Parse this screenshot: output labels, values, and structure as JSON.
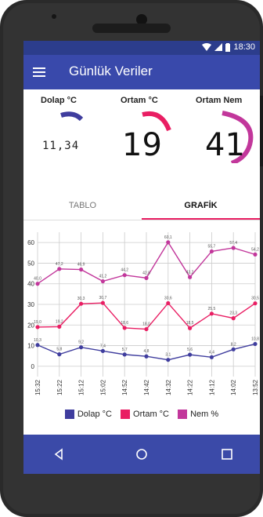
{
  "status": {
    "time": "18:30"
  },
  "appbar": {
    "title": "Günlük Veriler"
  },
  "gauges": {
    "dolap": {
      "label": "Dolap °C",
      "value": "11,34",
      "fraction": 0.2,
      "color": "#3f3d9e"
    },
    "ortam": {
      "label": "Ortam °C",
      "value": "19",
      "fraction": 0.25,
      "color": "#e91e63"
    },
    "nem": {
      "label": "Ortam Nem",
      "value": "41",
      "fraction": 0.41,
      "color": "#c2379b"
    }
  },
  "tabs": {
    "tablo": "TABLO",
    "grafik": "GRAFİK",
    "active": "GRAFİK"
  },
  "legend": {
    "dolap": "Dolap °C",
    "ortam": "Ortam °C",
    "nem": "Nem %"
  },
  "chart_data": {
    "type": "line",
    "categories": [
      "15:32",
      "15:22",
      "15:12",
      "15:02",
      "14:52",
      "14:42",
      "14:32",
      "14:22",
      "14:12",
      "14:02",
      "13:52"
    ],
    "ylim": [
      -5,
      65
    ],
    "yticks": [
      0,
      10,
      20,
      30,
      40,
      50,
      60
    ],
    "grid": true,
    "legend_position": "bottom",
    "series": [
      {
        "name": "Dolap °C",
        "color": "#3f3d9e",
        "values": [
          10.3,
          5.8,
          9.2,
          7.4,
          5.7,
          4.8,
          3.1,
          5.6,
          4.4,
          8.2,
          10.8
        ],
        "labels": [
          "10,3",
          "5,8",
          "9,2",
          "7,4",
          "5,7",
          "4,8",
          "3,1",
          "5,6",
          "4,4",
          "8,2",
          "10,8"
        ]
      },
      {
        "name": "Ortam °C",
        "color": "#e91e63",
        "values": [
          19.0,
          19.2,
          30.3,
          30.7,
          18.6,
          18.0,
          30.6,
          18.5,
          25.5,
          23.3,
          30.5
        ],
        "labels": [
          "19,0",
          "19,2",
          "30,3",
          "30,7",
          "18,6",
          "18,0",
          "30,6",
          "18,5",
          "25,5",
          "23,3",
          "30,5"
        ]
      },
      {
        "name": "Nem %",
        "color": "#c2379b",
        "values": [
          40.0,
          47.2,
          46.9,
          41.2,
          44.2,
          42.8,
          60.1,
          43.2,
          55.7,
          57.4,
          54.2
        ],
        "labels": [
          "40,0",
          "47,2",
          "46,9",
          "41,2",
          "44,2",
          "42,8",
          "60,1",
          "43,2",
          "55,7",
          "57,4",
          "54,2"
        ]
      }
    ]
  }
}
